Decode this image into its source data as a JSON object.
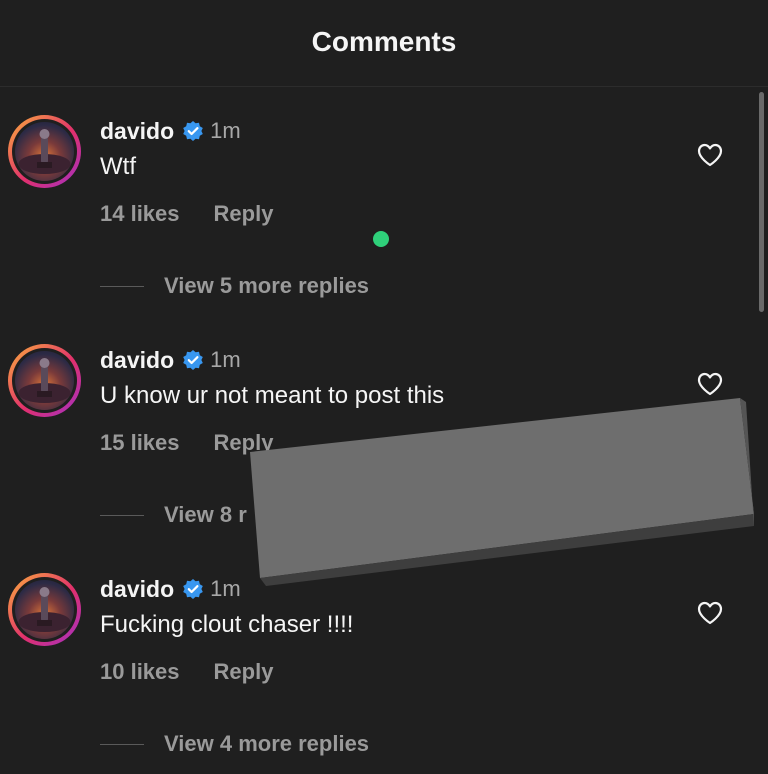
{
  "header": {
    "title": "Comments"
  },
  "comments": [
    {
      "username": "davido",
      "time": "1m",
      "text": "Wtf",
      "likes": "14 likes",
      "reply": "Reply",
      "view_replies": "View 5 more replies"
    },
    {
      "username": "davido",
      "time": "1m",
      "text": "U know ur not meant to post this",
      "likes": "15 likes",
      "reply": "Reply",
      "view_replies": "View 8 r"
    },
    {
      "username": "davido",
      "time": "1m",
      "text": "Fucking clout chaser !!!!",
      "likes": "10 likes",
      "reply": "Reply",
      "view_replies": "View 4 more replies"
    }
  ],
  "colors": {
    "background": "#1f1f1f",
    "verified": "#3897f0",
    "secondary_text": "#9a9a9a",
    "online_dot": "#2fd07a",
    "redaction_box": "#6e6e6e"
  },
  "icons": {
    "verified": "verified-badge-icon",
    "like": "heart-outline-icon"
  }
}
